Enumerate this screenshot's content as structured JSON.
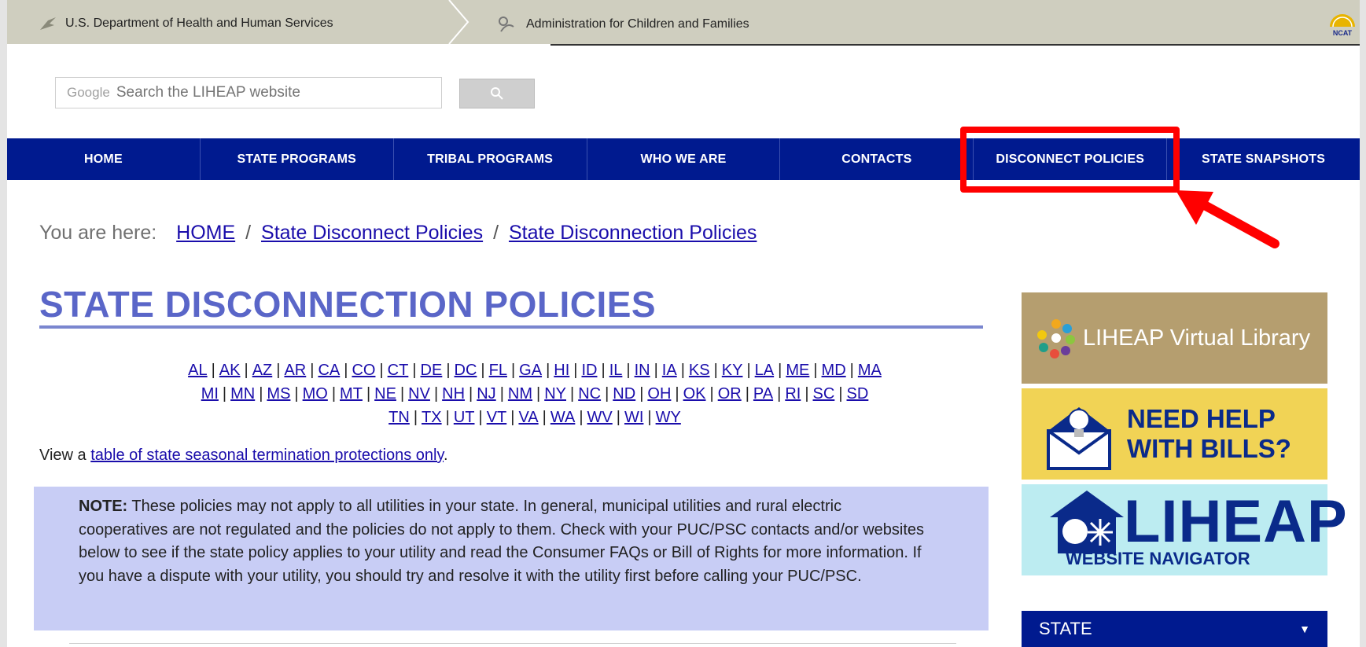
{
  "topbar": {
    "hhs": "U.S. Department of Health and Human Services",
    "acf": "Administration for Children and Families",
    "ncat": "NCAT"
  },
  "search": {
    "brand": "Google",
    "placeholder": "Search the LIHEAP website"
  },
  "nav": {
    "items": [
      "HOME",
      "STATE PROGRAMS",
      "TRIBAL PROGRAMS",
      "WHO WE ARE",
      "CONTACTS",
      "DISCONNECT POLICIES",
      "STATE SNAPSHOTS"
    ]
  },
  "breadcrumb": {
    "prefix": "You are here:",
    "home": "HOME",
    "sep": "/",
    "level1": "State Disconnect Policies",
    "level2": "State Disconnection Policies"
  },
  "page": {
    "title": "STATE DISCONNECTION POLICIES"
  },
  "states": {
    "row1": [
      "AL",
      "AK",
      "AZ",
      "AR",
      "CA",
      "CO",
      "CT",
      "DE",
      "DC",
      "FL",
      "GA",
      "HI",
      "ID",
      "IL",
      "IN",
      "IA",
      "KS",
      "KY",
      "LA",
      "ME",
      "MD",
      "MA"
    ],
    "row2": [
      "MI",
      "MN",
      "MS",
      "MO",
      "MT",
      "NE",
      "NV",
      "NH",
      "NJ",
      "NM",
      "NY",
      "NC",
      "ND",
      "OH",
      "OK",
      "OR",
      "PA",
      "RI",
      "SC",
      "SD"
    ],
    "row3": [
      "TN",
      "TX",
      "UT",
      "VT",
      "VA",
      "WA",
      "WV",
      "WI",
      "WY"
    ]
  },
  "viewtable": {
    "prefix": "View a",
    "link": "table of state seasonal termination protections only",
    "suffix": "."
  },
  "note": {
    "label": "NOTE:",
    "text": "These policies may not apply to all utilities in your state. In general, municipal utilities and rural electric cooperatives are not regulated and the policies do not apply to them. Check with your PUC/PSC contacts and/or websites below to see if the state policy applies to your utility and read the Consumer FAQs or Bill of Rights for more information. If you have a dispute with your utility, you should try and resolve it with the utility first before calling your PUC/PSC."
  },
  "sidebar": {
    "library": "LIHEAP Virtual Library",
    "help_line1": "NEED HELP",
    "help_line2": "WITH BILLS?",
    "navigator_big": "LIHEAP",
    "navigator_small": "WEBSITE NAVIGATOR",
    "state_label": "STATE",
    "state_caret": "▼"
  },
  "colors": {
    "nav_bg": "#001a8f",
    "highlight": "#ff0000",
    "title": "#5a66c8",
    "note_bg": "#c8cdf5"
  }
}
